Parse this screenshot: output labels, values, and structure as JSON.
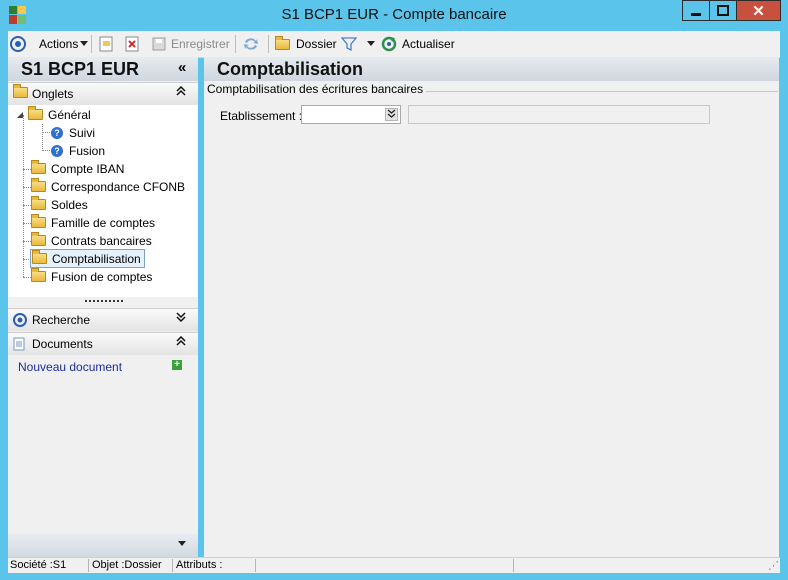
{
  "window": {
    "title": "S1 BCP1 EUR -  Compte bancaire",
    "controls": {
      "minimize": "minimize-icon",
      "maximize": "maximize-icon",
      "close": "✕"
    }
  },
  "toolbar": {
    "actions_label": "Actions",
    "save_label": "Enregistrer",
    "folder_label": "Dossier",
    "refresh_label": "Actualiser"
  },
  "left": {
    "object_title": "S1 BCP1 EUR",
    "collapse_glyph": "«",
    "tabs_section": "Onglets",
    "tree": [
      {
        "label": "Général",
        "children": [
          "Suivi",
          "Fusion"
        ]
      },
      {
        "label": "Compte IBAN"
      },
      {
        "label": "Correspondance CFONB"
      },
      {
        "label": "Soldes"
      },
      {
        "label": "Famille de comptes"
      },
      {
        "label": "Contrats bancaires"
      },
      {
        "label": "Comptabilisation",
        "selected": true
      },
      {
        "label": "Fusion de comptes"
      }
    ],
    "search_section": "Recherche",
    "documents_section": "Documents",
    "new_document": "Nouveau document"
  },
  "main": {
    "page_title": "Comptabilisation",
    "group_title": "Comptabilisation des écritures bancaires",
    "etablissement_label": "Etablissement :",
    "etablissement_value": "",
    "etablissement_description": ""
  },
  "status": {
    "societe": "Société :S1",
    "objet": "Objet :Dossier",
    "attributs": "Attributs :"
  },
  "colors": {
    "window_frame": "#5bc4ea",
    "close_button": "#c7503f",
    "link": "#1a2f9c",
    "selection": "#e5f1fb"
  }
}
